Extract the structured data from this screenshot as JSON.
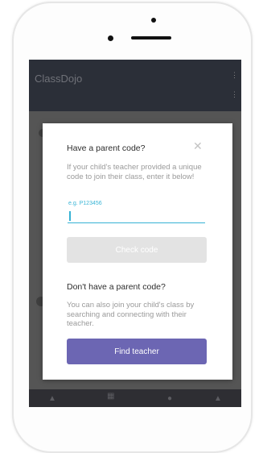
{
  "app": {
    "title": "ClassDojo"
  },
  "icons": {
    "overflow": "more-vert-icon",
    "close": "close-icon",
    "nav": [
      "home-icon",
      "story-icon",
      "messages-icon",
      "profile-icon"
    ]
  },
  "dialog": {
    "title": "Have a parent code?",
    "description": "If your child's teacher provided a unique code to join their class, enter it below!",
    "input": {
      "placeholder": "e.g. P123456",
      "value": ""
    },
    "check_button_label": "Check code",
    "section_title": "Don't have a parent code?",
    "section_description": "You can also join your child's class by searching and connecting with their teacher.",
    "find_button_label": "Find teacher"
  },
  "colors": {
    "accent": "#36b2d4",
    "primary_button": "#6c66b3",
    "disabled_button": "#e3e3e3",
    "app_bar": "#2b2f38"
  }
}
